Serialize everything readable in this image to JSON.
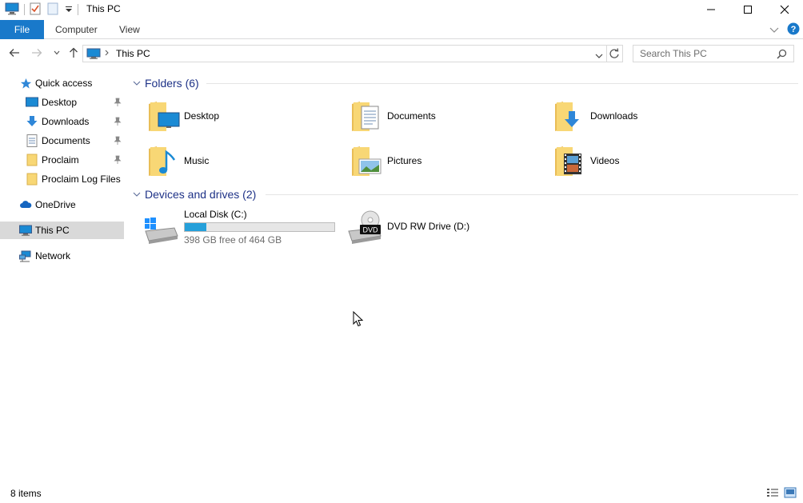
{
  "window": {
    "title": "This PC",
    "minimize_label": "",
    "maximize_label": "",
    "close_label": ""
  },
  "ribbon": {
    "file": "File",
    "tabs": [
      "Computer",
      "View"
    ]
  },
  "address": {
    "path": "This PC",
    "search_placeholder": "Search This PC"
  },
  "sidebar": {
    "quick_access": "Quick access",
    "quick_items": [
      {
        "label": "Desktop",
        "icon": "desktop-icon",
        "pinned": true
      },
      {
        "label": "Downloads",
        "icon": "downloads-icon",
        "pinned": true
      },
      {
        "label": "Documents",
        "icon": "documents-icon",
        "pinned": true
      },
      {
        "label": "Proclaim",
        "icon": "folder-icon",
        "pinned": true
      },
      {
        "label": "Proclaim Log Files",
        "icon": "folder-icon",
        "pinned": false
      }
    ],
    "onedrive": "OneDrive",
    "this_pc": "This PC",
    "network": "Network"
  },
  "folders": {
    "header": "Folders (6)",
    "items": [
      {
        "label": "Desktop",
        "icon": "desktop-folder-icon"
      },
      {
        "label": "Documents",
        "icon": "documents-folder-icon"
      },
      {
        "label": "Downloads",
        "icon": "downloads-folder-icon"
      },
      {
        "label": "Music",
        "icon": "music-folder-icon"
      },
      {
        "label": "Pictures",
        "icon": "pictures-folder-icon"
      },
      {
        "label": "Videos",
        "icon": "videos-folder-icon"
      }
    ]
  },
  "devices": {
    "header": "Devices and drives (2)",
    "local_disk": {
      "label": "Local Disk (C:)",
      "free": "398 GB free of 464 GB",
      "used_fraction": 0.142
    },
    "dvd": {
      "label": "DVD RW Drive (D:)",
      "badge": "DVD"
    }
  },
  "status": {
    "items": "8 items"
  },
  "colors": {
    "accent": "#1979ca",
    "group_header": "#1e3287",
    "folder": "#f8d775",
    "bar_fill": "#26a0da"
  }
}
